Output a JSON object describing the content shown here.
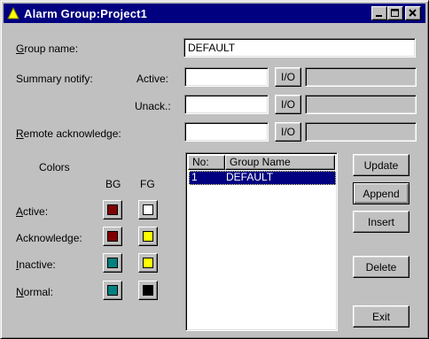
{
  "window": {
    "title": "Alarm Group:Project1",
    "controls": {
      "minimize": "minimize",
      "maximize": "maximize",
      "close": "close"
    }
  },
  "form": {
    "group_name_label": "Group name:",
    "group_name_value": "DEFAULT",
    "summary_notify_label": "Summary notify:",
    "active_label": "Active:",
    "active_value": "",
    "unack_label": "Unack.:",
    "unack_value": "",
    "remote_ack_label": "Remote acknowledge:",
    "remote_ack_value": "",
    "io_label": "I/O"
  },
  "colors": {
    "heading": "Colors",
    "bg_label": "BG",
    "fg_label": "FG",
    "rows": [
      {
        "label": "Active:",
        "bg": "#800000",
        "fg": "#ffffff"
      },
      {
        "label": "Acknowledge:",
        "bg": "#800000",
        "fg": "#ffff00"
      },
      {
        "label": "Inactive:",
        "bg": "#008080",
        "fg": "#ffff00"
      },
      {
        "label": "Normal:",
        "bg": "#008080",
        "fg": "#000000"
      }
    ]
  },
  "list": {
    "columns": [
      "No:",
      "Group Name"
    ],
    "rows": [
      {
        "no": "1",
        "name": "DEFAULT",
        "selected": true
      }
    ]
  },
  "buttons": {
    "update": "Update",
    "append": "Append",
    "insert": "Insert",
    "delete": "Delete",
    "exit": "Exit"
  },
  "theme": {
    "face": "#c0c0c0",
    "title_bar": "#000080",
    "selection": "#000080",
    "icon_color": "#ffff00"
  }
}
